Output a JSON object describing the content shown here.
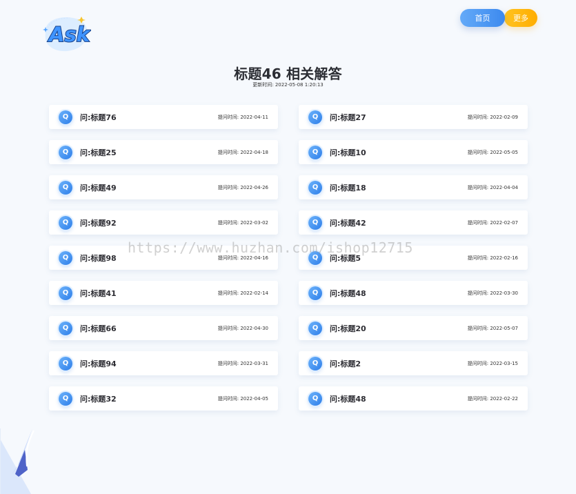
{
  "header": {
    "logo_text": "Ask",
    "nav": {
      "home_label": "首页",
      "more_label": "更多"
    }
  },
  "main": {
    "title": "标题46 相关解答",
    "updated_at": "更新时间: 2022-05-08 1:20:13"
  },
  "questions": [
    {
      "title": "问:标题76",
      "time": "提问时间: 2022-04-11"
    },
    {
      "title": "问:标题27",
      "time": "提问时间: 2022-02-09"
    },
    {
      "title": "问:标题25",
      "time": "提问时间: 2022-04-18"
    },
    {
      "title": "问:标题10",
      "time": "提问时间: 2022-05-05"
    },
    {
      "title": "问:标题49",
      "time": "提问时间: 2022-04-26"
    },
    {
      "title": "问:标题18",
      "time": "提问时间: 2022-04-04"
    },
    {
      "title": "问:标题92",
      "time": "提问时间: 2022-03-02"
    },
    {
      "title": "问:标题42",
      "time": "提问时间: 2022-02-07"
    },
    {
      "title": "问:标题98",
      "time": "提问时间: 2022-04-16"
    },
    {
      "title": "问:标题5",
      "time": "提问时间: 2022-02-16"
    },
    {
      "title": "问:标题41",
      "time": "提问时间: 2022-02-14"
    },
    {
      "title": "问:标题48",
      "time": "提问时间: 2022-03-30"
    },
    {
      "title": "问:标题66",
      "time": "提问时间: 2022-04-30"
    },
    {
      "title": "问:标题20",
      "time": "提问时间: 2022-05-07"
    },
    {
      "title": "问:标题94",
      "time": "提问时间: 2022-03-31"
    },
    {
      "title": "问:标题2",
      "time": "提问时间: 2022-03-15"
    },
    {
      "title": "问:标题32",
      "time": "提问时间: 2022-04-05"
    },
    {
      "title": "问:标题48",
      "time": "提问时间: 2022-02-22"
    }
  ],
  "icons": {
    "question": "question-icon"
  },
  "watermark": "https://www.huzhan.com/ishop12715",
  "colors": {
    "primary": "#3c89ef",
    "accent": "#ffad00",
    "background": "#f6f9fd"
  }
}
